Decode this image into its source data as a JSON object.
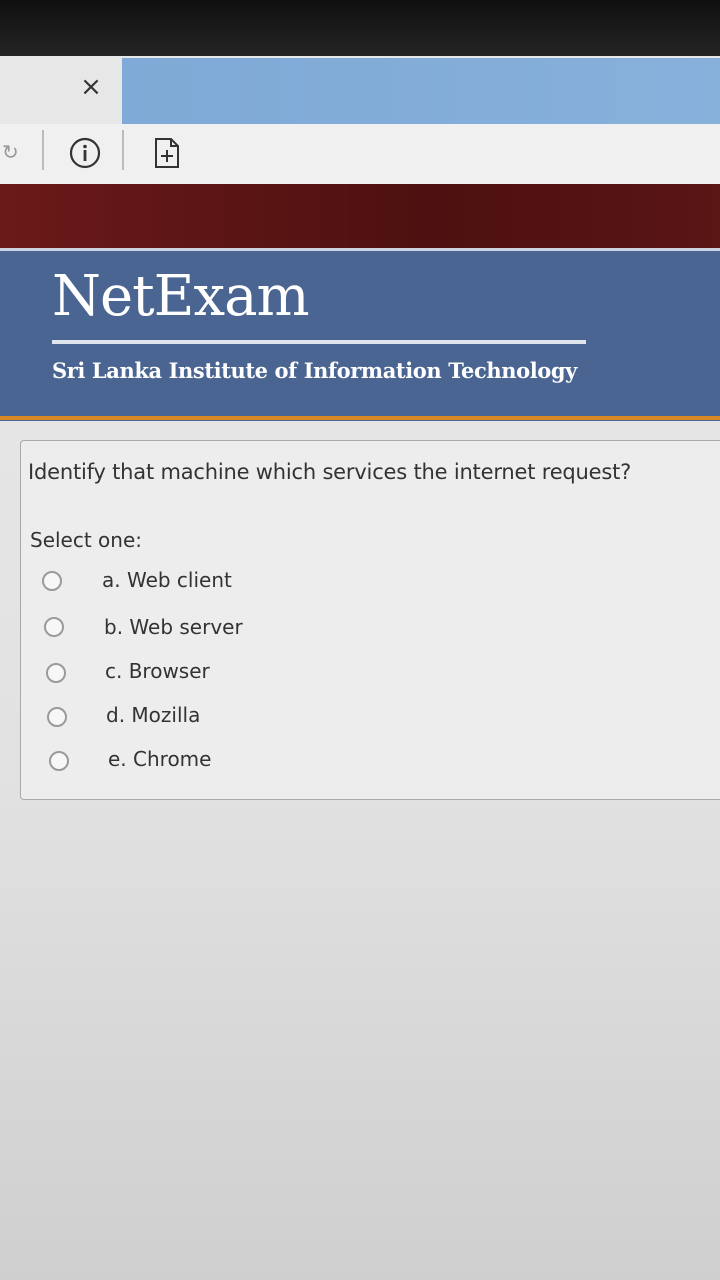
{
  "browser": {
    "close_glyph": "×",
    "back_glyph": "↻",
    "icons": [
      "close-icon",
      "info-icon",
      "new-page-icon"
    ]
  },
  "site": {
    "logo": "NetExam",
    "subtitle": "Sri Lanka Institute of Information Technology",
    "colors": {
      "header": "#4a6592",
      "frame": "#5a1515",
      "accent": "#d98a24"
    }
  },
  "question": {
    "text": "Identify that machine which services the internet request?",
    "select_label": "Select one:",
    "options": [
      {
        "label": "a. Web client",
        "selected": false
      },
      {
        "label": "b. Web server",
        "selected": false
      },
      {
        "label": "c. Browser",
        "selected": false
      },
      {
        "label": "d. Mozilla",
        "selected": false
      },
      {
        "label": "e. Chrome",
        "selected": false
      }
    ]
  }
}
